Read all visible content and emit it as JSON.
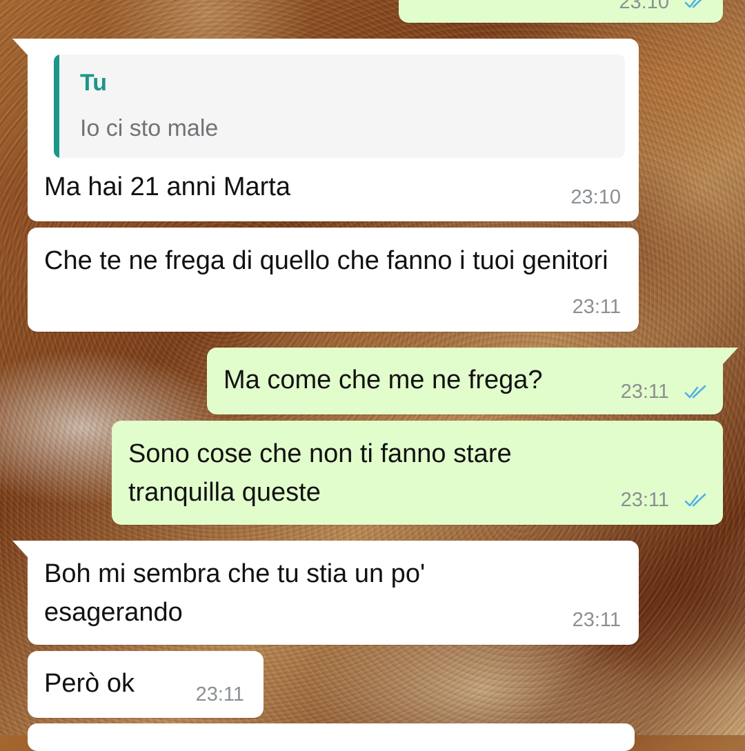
{
  "colors": {
    "incoming_bubble": "#ffffff",
    "outgoing_bubble": "#e2fdcc",
    "quote_accent": "#1b9688",
    "read_ticks": "#4fb0e6",
    "timestamp": "#8a8f93"
  },
  "messages": [
    {
      "direction": "outgoing",
      "text": "",
      "time": "23:10",
      "status": "read",
      "icon": "double-check-icon"
    },
    {
      "direction": "incoming",
      "reply_to": {
        "author": "Tu",
        "text": "Io ci sto male"
      },
      "text": "Ma hai 21 anni Marta",
      "time": "23:10"
    },
    {
      "direction": "incoming",
      "text": "Che te ne frega di quello che fanno i tuoi genitori",
      "time": "23:11"
    },
    {
      "direction": "outgoing",
      "text": "Ma come che me ne frega?",
      "time": "23:11",
      "status": "read",
      "icon": "double-check-icon"
    },
    {
      "direction": "outgoing",
      "text": "Sono cose che non ti fanno stare tranquilla queste",
      "time": "23:11",
      "status": "read",
      "icon": "double-check-icon"
    },
    {
      "direction": "incoming",
      "text": "Boh mi sembra che tu stia un po' esagerando",
      "time": "23:11"
    },
    {
      "direction": "incoming",
      "text": "Però ok",
      "time": "23:11"
    },
    {
      "direction": "incoming",
      "text": "",
      "time": ""
    }
  ]
}
